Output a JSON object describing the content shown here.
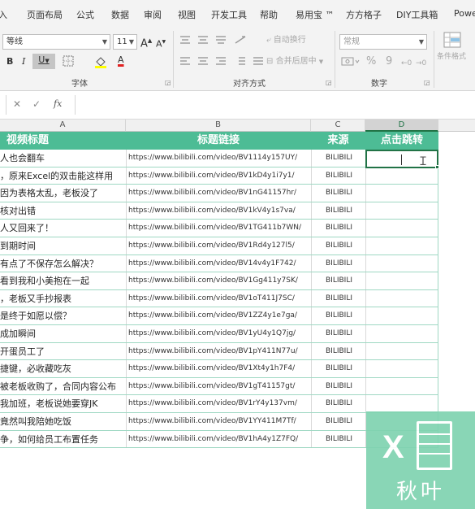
{
  "ribbon_tabs": [
    "入",
    "页面布局",
    "公式",
    "数据",
    "审阅",
    "视图",
    "开发工具",
    "帮助",
    "易用宝 ™",
    "方方格子",
    "DIY工具箱",
    "Powe"
  ],
  "font": {
    "name_value": "等线",
    "size_value": "11",
    "grow_label": "A",
    "shrink_label": "A",
    "bold_label": "B",
    "italic_label": "I",
    "underline_label": "U",
    "group_label": "字体"
  },
  "alignment": {
    "wrap_text_label": "自动换行",
    "merge_center_label": "合并后居中",
    "group_label": "对齐方式"
  },
  "number": {
    "format_value": "常规",
    "percent_label": "%",
    "comma_label": "9",
    "group_label": "数字"
  },
  "styles": {
    "conditional_format_label": "条件格式"
  },
  "formula_bar": {
    "cancel_icon": "✕",
    "confirm_icon": "✓",
    "fx_label": "fx",
    "value": ""
  },
  "columns": [
    "A",
    "B",
    "C",
    "D"
  ],
  "table": {
    "headers": [
      "视频标题",
      "标题链接",
      "来源",
      "点击跳转"
    ],
    "rows": [
      {
        "title": "人也会翻车",
        "link": "https://www.bilibili.com/video/BV1114y157UY/",
        "source": "BILIBILI"
      },
      {
        "title": "，原来Excel的双击能这样用",
        "link": "https://www.bilibili.com/video/BV1kD4y1i7y1/",
        "source": "BILIBILI"
      },
      {
        "title": "因为表格太乱，老板没了",
        "link": "https://www.bilibili.com/video/BV1nG41157hr/",
        "source": "BILIBILI"
      },
      {
        "title": "核对出错",
        "link": "https://www.bilibili.com/video/BV1kV4y1s7va/",
        "source": "BILIBILI"
      },
      {
        "title": "人又回来了！",
        "link": "https://www.bilibili.com/video/BV1TG411b7WN/",
        "source": "BILIBILI"
      },
      {
        "title": "到期时间",
        "link": "https://www.bilibili.com/video/BV1Rd4y127l5/",
        "source": "BILIBILI"
      },
      {
        "title": "有点了不保存怎么解决？",
        "link": "https://www.bilibili.com/video/BV14v4y1F742/",
        "source": "BILIBILI"
      },
      {
        "title": "看到我和小美抱在一起",
        "link": "https://www.bilibili.com/video/BV1Gg411y7SK/",
        "source": "BILIBILI"
      },
      {
        "title": "，老板又手抄报表",
        "link": "https://www.bilibili.com/video/BV1oT411J7SC/",
        "source": "BILIBILI"
      },
      {
        "title": "是终于如愿以偿？",
        "link": "https://www.bilibili.com/video/BV1ZZ4y1e7ga/",
        "source": "BILIBILI"
      },
      {
        "title": "成加瞬间",
        "link": "https://www.bilibili.com/video/BV1yU4y1Q7jg/",
        "source": "BILIBILI"
      },
      {
        "title": "开蛋员工了",
        "link": "https://www.bilibili.com/video/BV1pY411N77u/",
        "source": "BILIBILI"
      },
      {
        "title": "捷键，必收藏吃灰",
        "link": "https://www.bilibili.com/video/BV1Xt4y1h7F4/",
        "source": "BILIBILI"
      },
      {
        "title": "被老板收购了，合同内容公布",
        "link": "https://www.bilibili.com/video/BV1gT41157gt/",
        "source": "BILIBILI"
      },
      {
        "title": "我加班，老板说她要穿JK",
        "link": "https://www.bilibili.com/video/BV1rY4y137vm/",
        "source": "BILIBILI"
      },
      {
        "title": "竟然叫我陪她吃饭",
        "link": "https://www.bilibili.com/video/BV1YY411M7Tf/",
        "source": "BILIBILI"
      },
      {
        "title": "争，如何给员工布置任务",
        "link": "https://www.bilibili.com/video/BV1hA4y1Z7FQ/",
        "source": "BILIBILI"
      }
    ]
  },
  "watermark": {
    "logo_text": "X",
    "name": "秋叶"
  },
  "colors": {
    "header_fill": "#4dbc95",
    "row_border": "#9fd8c3",
    "selection": "#217346",
    "watermark": "#7fd3b0"
  }
}
